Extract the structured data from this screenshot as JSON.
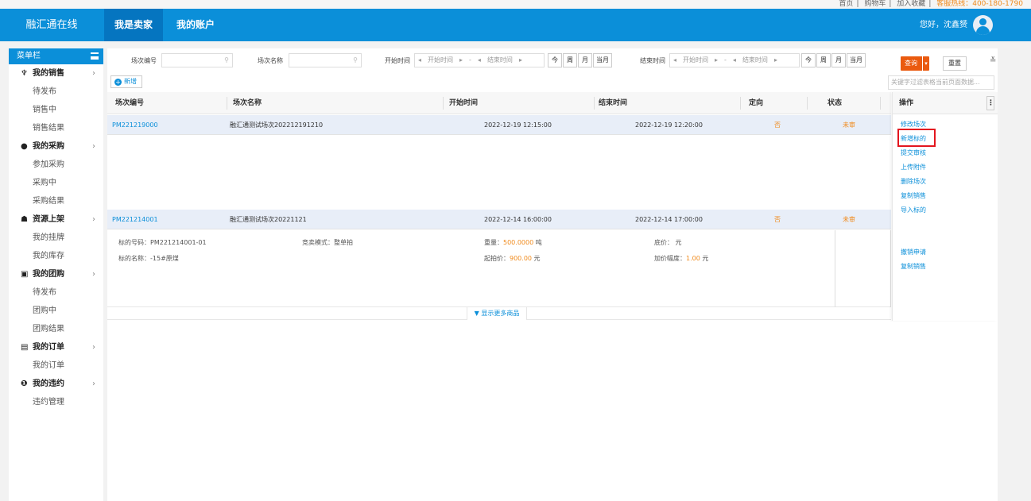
{
  "toplinks": [
    "首页",
    "购物车",
    "加入收藏",
    "客服热线：400-180-1790"
  ],
  "header": {
    "logo": "融汇通在线",
    "nav_seller": "我是卖家",
    "nav_account": "我的账户",
    "greeting": "您好，沈鑫赟"
  },
  "sidebar": {
    "title": "菜单栏",
    "groups": [
      {
        "label": "我的销售",
        "icon": "♆",
        "items": [
          "待发布",
          "销售中",
          "销售结果"
        ]
      },
      {
        "label": "我的采购",
        "icon": "●",
        "items": [
          "参加采购",
          "采购中",
          "采购结果"
        ]
      },
      {
        "label": "资源上架",
        "icon": "☗",
        "items": [
          "我的挂牌",
          "我的库存"
        ]
      },
      {
        "label": "我的团购",
        "icon": "▣",
        "items": [
          "待发布",
          "团购中",
          "团购结果"
        ]
      },
      {
        "label": "我的订单",
        "icon": "▤",
        "items": [
          "我的订单"
        ]
      },
      {
        "label": "我的违约",
        "icon": "❶",
        "items": [
          "违约管理"
        ]
      }
    ]
  },
  "filters": {
    "code_label": "场次编号",
    "name_label": "场次名称",
    "start_label": "开始时间",
    "end_label": "结束时间",
    "start_placeholder": "开始时间",
    "end_placeholder": "结束时间",
    "range_sep": "-",
    "quick": [
      "今",
      "周",
      "月",
      "当月"
    ],
    "query": "查询",
    "reset": "重置"
  },
  "toolbar": {
    "add": "新增",
    "keyword_placeholder": "关键字过滤表格当前页面数据..."
  },
  "table": {
    "headers": [
      "场次编号",
      "场次名称",
      "开始时间",
      "结束时间",
      "定向",
      "状态"
    ],
    "ops_header": "操作",
    "rows": [
      {
        "code": "PM221219000",
        "name": "融汇通测试场次202212191210",
        "start": "2022-12-19 12:15:00",
        "end": "2022-12-19 12:20:00",
        "direct": "否",
        "status": "未审"
      },
      {
        "code": "PM221214001",
        "name": "融汇通测试场次20221121",
        "start": "2022-12-14 16:00:00",
        "end": "2022-12-14 17:00:00",
        "direct": "否",
        "status": "未审"
      }
    ],
    "row1_ops": [
      "修改场次",
      "新增标的",
      "提交审核",
      "上传附件",
      "删除场次",
      "复制销售",
      "导入标的"
    ],
    "row2_ops": [
      "撤销申请",
      "复制销售"
    ]
  },
  "detail": {
    "lot_no_label": "标的号码：",
    "lot_no": "PM221214001-01",
    "mode_label": "竞卖模式：",
    "mode": "整单拍",
    "qty_label": "重量：",
    "qty": "500.0000",
    "qty_unit": "吨",
    "base_label": "底价：",
    "base_unit": "元",
    "lot_name_label": "标的名称：",
    "lot_name": "-15#原煤",
    "start_price_label": "起拍价：",
    "start_price": "900.00",
    "price_unit": "元",
    "inc_label": "加价幅度：",
    "inc": "1.00",
    "inc_unit": "元",
    "more": "▼ 显示更多商品"
  },
  "colors": {
    "brand": "#0b8fd9",
    "accent": "#ea5a0f",
    "highlight": "#e3161e"
  }
}
